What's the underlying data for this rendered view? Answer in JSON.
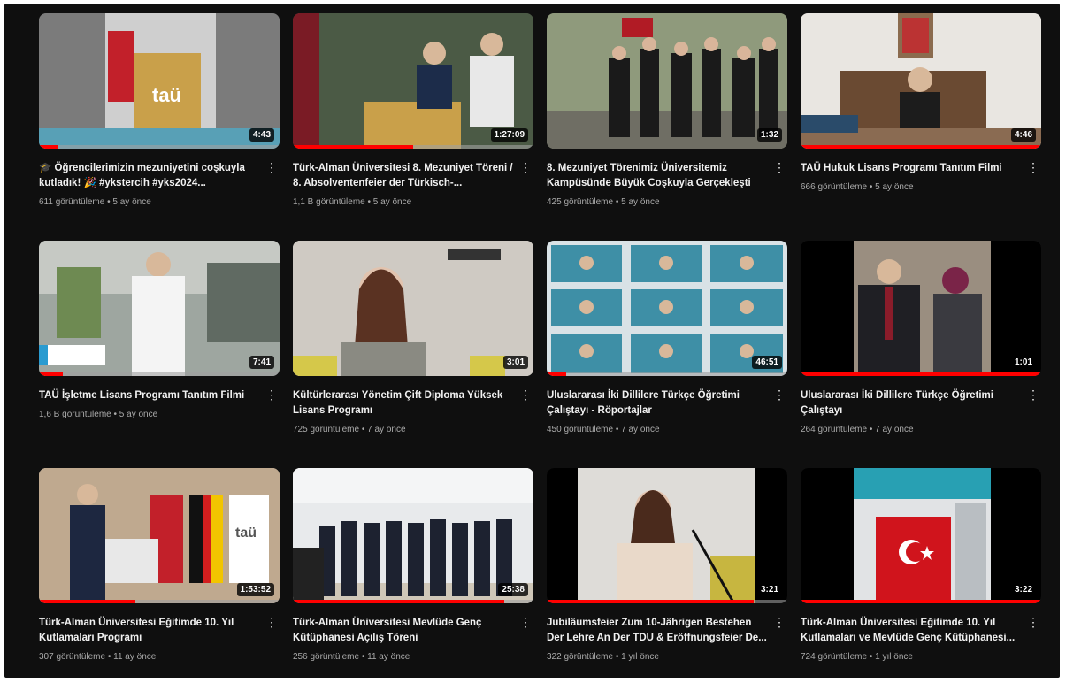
{
  "videos": [
    {
      "title": "🎓 Öğrencilerimizin mezuniyetini coşkuyla kutladık! 🎉 #ykstercih #yks2024...",
      "views": "611 görüntüleme",
      "age": "5 ay önce",
      "duration": "4:43",
      "progress": 0.08,
      "more_icon": "more-vert-icon"
    },
    {
      "title": "Türk-Alman Üniversitesi 8. Mezuniyet Töreni / 8. Absolventenfeier der Türkisch-...",
      "views": "1,1 B görüntüleme",
      "age": "5 ay önce",
      "duration": "1:27:09",
      "progress": 0.5,
      "more_icon": "more-vert-icon"
    },
    {
      "title": "8. Mezuniyet Törenimiz Üniversitemiz Kampüsünde Büyük Coşkuyla Gerçekleşti",
      "views": "425 görüntüleme",
      "age": "5 ay önce",
      "duration": "1:32",
      "progress": 0,
      "more_icon": "more-vert-icon"
    },
    {
      "title": "TAÜ Hukuk Lisans Programı Tanıtım Filmi",
      "views": "666 görüntüleme",
      "age": "5 ay önce",
      "duration": "4:46",
      "progress": 1,
      "more_icon": "more-vert-icon"
    },
    {
      "title": "TAÜ İşletme Lisans Programı Tanıtım Filmi",
      "views": "1,6 B görüntüleme",
      "age": "5 ay önce",
      "duration": "7:41",
      "progress": 0.1,
      "more_icon": "more-vert-icon"
    },
    {
      "title": "Kültürlerarası Yönetim Çift Diploma Yüksek Lisans Programı",
      "views": "725 görüntüleme",
      "age": "7 ay önce",
      "duration": "3:01",
      "progress": 0,
      "more_icon": "more-vert-icon"
    },
    {
      "title": "Uluslararası İki Dillilere Türkçe Öğretimi Çalıştayı - Röportajlar",
      "views": "450 görüntüleme",
      "age": "7 ay önce",
      "duration": "46:51",
      "progress": 0.08,
      "more_icon": "more-vert-icon"
    },
    {
      "title": "Uluslararası İki Dillilere Türkçe Öğretimi Çalıştayı",
      "views": "264 görüntüleme",
      "age": "7 ay önce",
      "duration": "1:01",
      "progress": 1,
      "more_icon": "more-vert-icon"
    },
    {
      "title": "Türk-Alman Üniversitesi Eğitimde 10. Yıl Kutlamaları Programı",
      "views": "307 görüntüleme",
      "age": "11 ay önce",
      "duration": "1:53:52",
      "progress": 0.4,
      "more_icon": "more-vert-icon"
    },
    {
      "title": "Türk-Alman Üniversitesi Mevlüde Genç Kütüphanesi Açılış Töreni",
      "views": "256 görüntüleme",
      "age": "11 ay önce",
      "duration": "25:38",
      "progress": 0.88,
      "more_icon": "more-vert-icon"
    },
    {
      "title": "Jubiläumsfeier Zum 10-Jährigen Bestehen Der Lehre An Der TDU & Eröffnungsfeier De...",
      "views": "322 görüntüleme",
      "age": "1 yıl önce",
      "duration": "3:21",
      "progress": 0.86,
      "more_icon": "more-vert-icon"
    },
    {
      "title": "Türk-Alman Üniversitesi Eğitimde 10. Yıl Kutlamaları ve Mevlüde Genç Kütüphanesi...",
      "views": "724 görüntüleme",
      "age": "1 yıl önce",
      "duration": "3:22",
      "progress": 1,
      "more_icon": "more-vert-icon"
    }
  ],
  "separator": "•",
  "colors": {
    "background": "#0f0f0f",
    "progress": "#ff0000",
    "title": "#f1f1f1",
    "meta": "#aaaaaa"
  }
}
